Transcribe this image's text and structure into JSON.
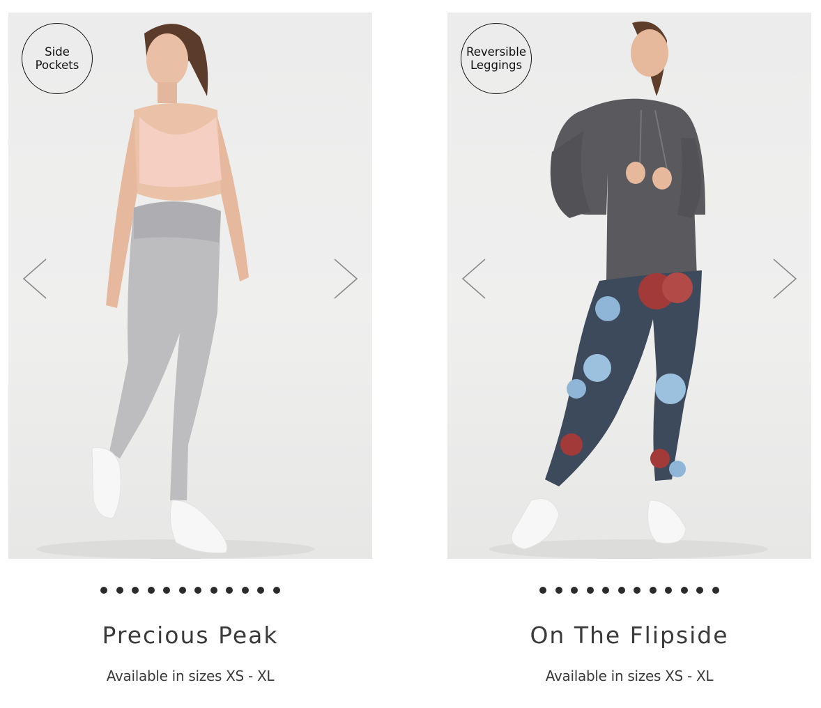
{
  "products": [
    {
      "badge_line1": "Side",
      "badge_line2": "Pockets",
      "name": "Precious Peak",
      "availability": "Available in sizes XS - XL",
      "dot_count": 12,
      "image_alt": "Model wearing light gray leggings and peach sports bra",
      "colors": {
        "leggings": "#bdbdc0",
        "top": "#f6cfc3"
      }
    },
    {
      "badge_line1": "Reversible",
      "badge_line2": "Leggings",
      "name": "On The Flipside",
      "availability": "Available in sizes XS - XL",
      "dot_count": 12,
      "image_alt": "Model wearing navy floral leggings and charcoal hoodie",
      "colors": {
        "leggings": "#3c4a5c",
        "top": "#5a595d"
      }
    }
  ],
  "icons": {
    "prev": "chevron-left-icon",
    "next": "chevron-right-icon"
  }
}
